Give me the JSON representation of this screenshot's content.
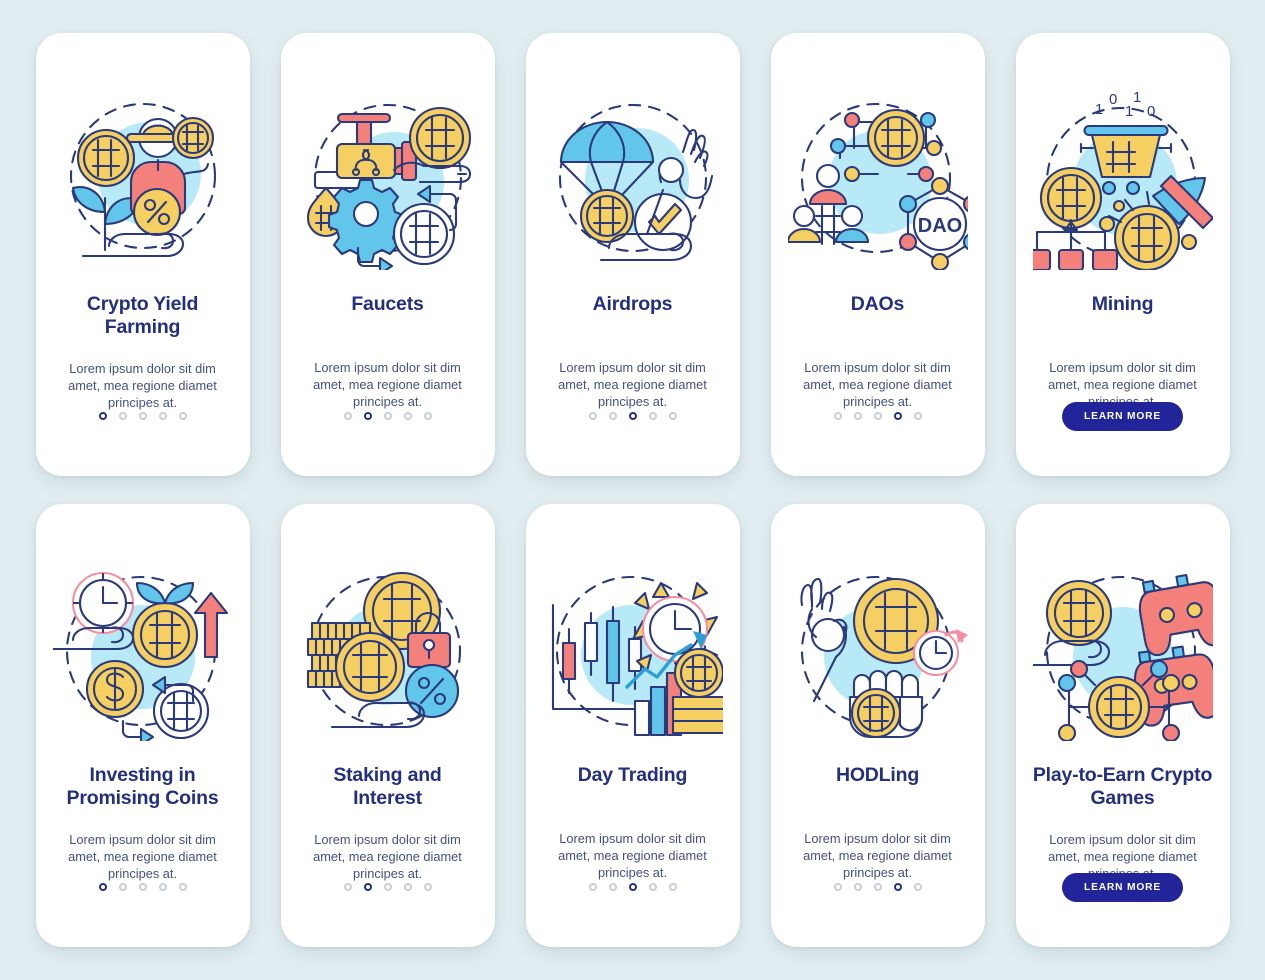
{
  "page": {
    "background_color": "#e2eef1",
    "card_background": "#ffffff",
    "title_color": "#24307e",
    "body_color": "#44507f",
    "accent_button_color": "#22249a",
    "dot_active_color": "#24307e",
    "dot_inactive_color": "#c9cdd6"
  },
  "palette": {
    "yellow": "#f6cf62",
    "light_blue": "#b7e9f6",
    "sky_blue": "#62c6ea",
    "coral": "#f4807c",
    "navy": "#2b3a7a",
    "white": "#ffffff"
  },
  "shared": {
    "body_text": "Lorem ipsum dolor sit dim amet, mea regione diamet principes at.",
    "learn_more_label": "LEARN MORE",
    "dot_count": 5
  },
  "screens": [
    {
      "id": "crypto-yield-farming",
      "title": "Crypto Yield Farming",
      "body": "Lorem ipsum dolor sit dim amet, mea regione diamet principes at.",
      "icon": "farmer-coin-plant-percent-hand-icon",
      "footer_type": "dots",
      "active_dot": 1,
      "dot_count": 5
    },
    {
      "id": "faucets",
      "title": "Faucets",
      "body": "Lorem ipsum dolor sit dim amet, mea regione diamet principes at.",
      "icon": "faucet-gear-coins-hand-icon",
      "footer_type": "dots",
      "active_dot": 2,
      "dot_count": 5
    },
    {
      "id": "airdrops",
      "title": "Airdrops",
      "body": "Lorem ipsum dolor sit dim amet, mea regione diamet principes at.",
      "icon": "parachute-coin-checkmark-ok-hand-icon",
      "footer_type": "dots",
      "active_dot": 3,
      "dot_count": 5
    },
    {
      "id": "daos",
      "title": "DAOs",
      "body": "Lorem ipsum dolor sit dim amet, mea regione diamet principes at.",
      "icon": "dao-network-people-coin-icon",
      "icon_label": "DAO",
      "footer_type": "dots",
      "active_dot": 4,
      "dot_count": 5
    },
    {
      "id": "mining",
      "title": "Mining",
      "body": "Lorem ipsum dolor sit dim amet, mea regione diamet principes at.",
      "icon": "pickaxe-coins-binary-bucket-icon",
      "icon_binary": "1 0 1 0 1",
      "footer_type": "button",
      "button_label": "LEARN MORE",
      "active_dot": 5,
      "dot_count": 5
    },
    {
      "id": "investing-in-promising-coins",
      "title": "Investing in Promising Coins",
      "body": "Lorem ipsum dolor sit dim amet, mea regione diamet principes at.",
      "icon": "clock-growth-coin-arrow-exchange-icon",
      "footer_type": "dots",
      "active_dot": 1,
      "dot_count": 5
    },
    {
      "id": "staking-and-interest",
      "title": "Staking and Interest",
      "body": "Lorem ipsum dolor sit dim amet, mea regione diamet principes at.",
      "icon": "coin-stack-lock-percent-hand-icon",
      "footer_type": "dots",
      "active_dot": 2,
      "dot_count": 5
    },
    {
      "id": "day-trading",
      "title": "Day Trading",
      "body": "Lorem ipsum dolor sit dim amet, mea regione diamet principes at.",
      "icon": "candlestick-chart-clock-trendline-coins-icon",
      "footer_type": "dots",
      "active_dot": 3,
      "dot_count": 5
    },
    {
      "id": "hodling",
      "title": "HODLing",
      "body": "Lorem ipsum dolor sit dim amet, mea regione diamet principes at.",
      "icon": "fist-holding-coin-clock-ok-hand-icon",
      "footer_type": "dots",
      "active_dot": 4,
      "dot_count": 5
    },
    {
      "id": "play-to-earn-crypto-games",
      "title": "Play-to-Earn Crypto Games",
      "body": "Lorem ipsum dolor sit dim amet, mea regione diamet principes at.",
      "icon": "gamepad-coin-network-hand-icon",
      "footer_type": "button",
      "button_label": "LEARN MORE",
      "active_dot": 5,
      "dot_count": 5
    }
  ]
}
